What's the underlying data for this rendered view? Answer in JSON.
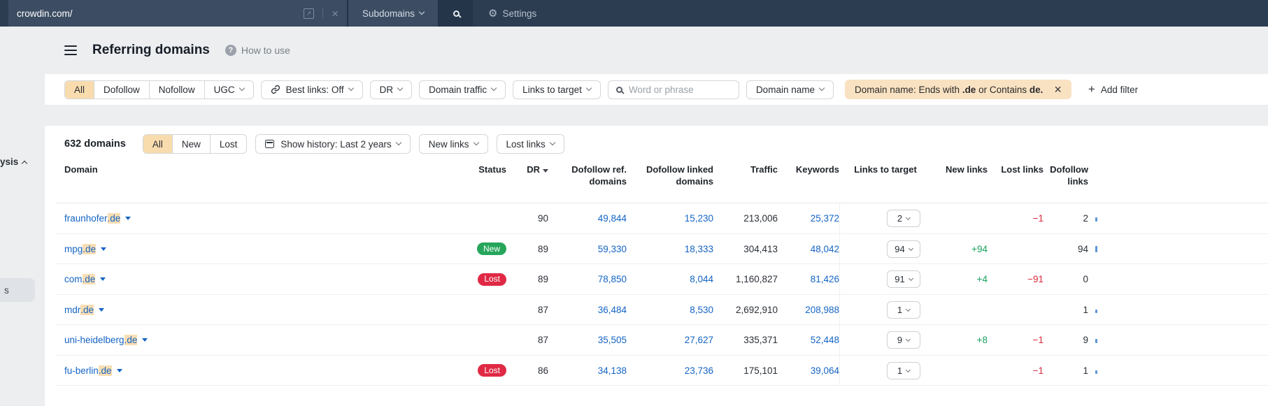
{
  "topbar": {
    "target_value": "crowdin.com/",
    "mode": "Subdomains",
    "settings": "Settings"
  },
  "sidebar": {
    "partial_section": "ysis",
    "partial_item": "s"
  },
  "header": {
    "title": "Referring domains",
    "help": "How to use"
  },
  "filterbar": {
    "link_type": {
      "options": [
        "All",
        "Dofollow",
        "Nofollow",
        "UGC"
      ],
      "selected": "All"
    },
    "best_links": "Best links: Off",
    "dr": "DR",
    "domain_traffic": "Domain traffic",
    "links_to_target": "Links to target",
    "search_placeholder": "Word or phrase",
    "domain_name": "Domain name",
    "active_filter": {
      "text_1": "Domain name: Ends with ",
      "bold_1": ".de",
      "text_2": " or Contains ",
      "bold_2": "de."
    },
    "add_filter": "Add filter"
  },
  "toolbar": {
    "count": "632 domains",
    "status_tabs": {
      "options": [
        "All",
        "New",
        "Lost"
      ],
      "selected": "All"
    },
    "show_history": "Show history: Last 2 years",
    "new_links": "New links",
    "lost_links": "Lost links"
  },
  "table": {
    "headers": {
      "domain": "Domain",
      "status": "Status",
      "dr": "DR",
      "dofollow_ref": "Dofollow ref. domains",
      "dofollow_linked": "Dofollow linked domains",
      "traffic": "Traffic",
      "keywords": "Keywords",
      "links_to_target": "Links to target",
      "new_links": "New links",
      "lost_links": "Lost links",
      "dofollow_links": "Dofollow links"
    },
    "rows": [
      {
        "domain_prefix": "fraunhofer",
        "domain_match": ".de",
        "status": "",
        "dr": "90",
        "dofollow_ref": "49,844",
        "dofollow_linked": "15,230",
        "traffic": "213,006",
        "keywords": "25,372",
        "links_to_target": "2",
        "new_links": "",
        "lost_links": "−1",
        "dofollow_links": "2",
        "spark": 6
      },
      {
        "domain_prefix": "mpg",
        "domain_match": ".de",
        "status": "New",
        "dr": "89",
        "dofollow_ref": "59,330",
        "dofollow_linked": "18,333",
        "traffic": "304,413",
        "keywords": "48,042",
        "links_to_target": "94",
        "new_links": "+94",
        "lost_links": "",
        "dofollow_links": "94",
        "spark": 9
      },
      {
        "domain_prefix": "com",
        "domain_match": ".de",
        "status": "Lost",
        "dr": "89",
        "dofollow_ref": "78,850",
        "dofollow_linked": "8,044",
        "traffic": "1,160,827",
        "keywords": "81,426",
        "links_to_target": "91",
        "new_links": "+4",
        "lost_links": "−91",
        "dofollow_links": "0",
        "spark": 0
      },
      {
        "domain_prefix": "mdr",
        "domain_match": ".de",
        "status": "",
        "dr": "87",
        "dofollow_ref": "36,484",
        "dofollow_linked": "8,530",
        "traffic": "2,692,910",
        "keywords": "208,988",
        "links_to_target": "1",
        "new_links": "",
        "lost_links": "",
        "dofollow_links": "1",
        "spark": 5
      },
      {
        "domain_prefix": "uni-heidelberg",
        "domain_match": ".de",
        "status": "",
        "dr": "87",
        "dofollow_ref": "35,505",
        "dofollow_linked": "27,627",
        "traffic": "335,371",
        "keywords": "52,448",
        "links_to_target": "9",
        "new_links": "+8",
        "lost_links": "−1",
        "dofollow_links": "9",
        "spark": 6
      },
      {
        "domain_prefix": "fu-berlin",
        "domain_match": ".de",
        "status": "Lost",
        "dr": "86",
        "dofollow_ref": "34,138",
        "dofollow_linked": "23,736",
        "traffic": "175,101",
        "keywords": "39,064",
        "links_to_target": "1",
        "new_links": "",
        "lost_links": "−1",
        "dofollow_links": "1",
        "spark": 5
      }
    ]
  },
  "colors": {
    "topbar_bg": "#2c3d52",
    "accent_orange": "#f8dcae",
    "chip_orange": "#f9e2c2",
    "link_blue": "#1464c4",
    "green_text": "#18a15f",
    "red_text": "#d8293d",
    "badge_new": "#26a65b",
    "badge_lost": "#e02a45",
    "spark_blue": "#5b94d6"
  }
}
